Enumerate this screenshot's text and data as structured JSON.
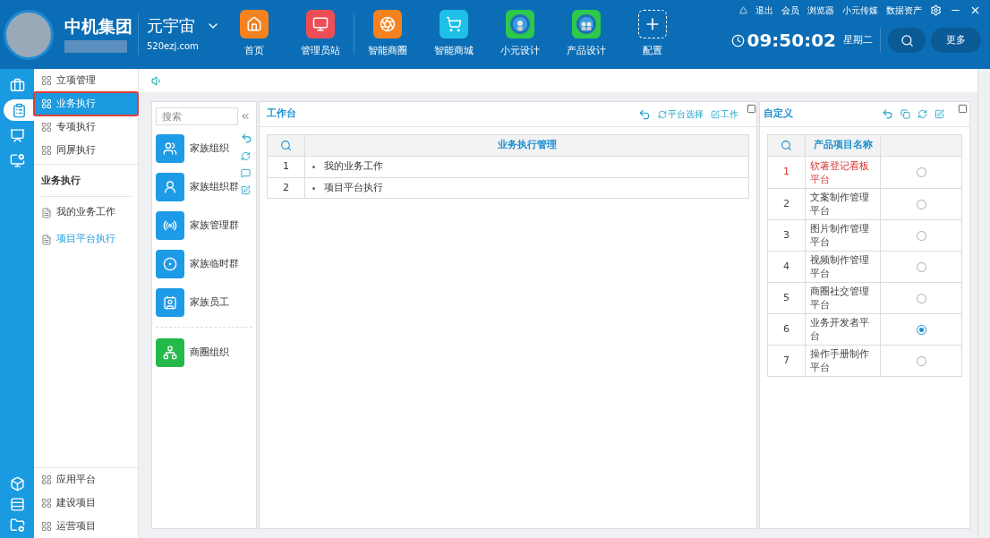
{
  "header": {
    "company": "中机集团",
    "brand": "元宇宙",
    "domain": "520ezj.com",
    "nav": [
      {
        "label": "首页",
        "kind": "home",
        "color": "#f5821f"
      },
      {
        "label": "管理员站",
        "kind": "monitor",
        "color": "#ee4d55"
      },
      {
        "label": "智能商圈",
        "kind": "aperture",
        "color": "#f5821f"
      },
      {
        "label": "智能商城",
        "kind": "cart",
        "color": "#1ec0e8"
      },
      {
        "label": "小元设计",
        "kind": "globe",
        "color": "#2ec84a"
      },
      {
        "label": "产品设计",
        "kind": "globe2",
        "color": "#2ec84a"
      },
      {
        "label": "配置",
        "kind": "add",
        "color": "#0b6db5"
      }
    ],
    "top_links": [
      "退出",
      "会员",
      "浏览器",
      "小元传媒",
      "数据资产"
    ],
    "time": "09:50:02",
    "weekday": "星期二",
    "more": "更多"
  },
  "rail": [
    {
      "kind": "briefcase",
      "selected": false
    },
    {
      "kind": "list",
      "selected": true
    },
    {
      "kind": "chart",
      "selected": false
    },
    {
      "kind": "screen",
      "selected": false
    }
  ],
  "rail_bottom": [
    {
      "kind": "cube"
    },
    {
      "kind": "rows"
    },
    {
      "kind": "folder"
    }
  ],
  "menu": {
    "items": [
      {
        "label": "立项管理",
        "selected": false
      },
      {
        "label": "业务执行",
        "selected": true
      },
      {
        "label": "专项执行",
        "selected": false
      },
      {
        "label": "同屏执行",
        "selected": false
      }
    ],
    "section_title": "业务执行",
    "sub_items": [
      {
        "label": "我的业务工作",
        "selected": false
      },
      {
        "label": "项目平台执行",
        "selected": true
      }
    ],
    "bottom_items": [
      "应用平台",
      "建设项目",
      "运营项目"
    ]
  },
  "groups": {
    "search_placeholder": "搜索",
    "items": [
      {
        "label": "家族组织",
        "kind": "people",
        "color": "#1e9be6"
      },
      {
        "label": "家族组织群",
        "kind": "person",
        "color": "#1e9be6"
      },
      {
        "label": "家族管理群",
        "kind": "signal",
        "color": "#1e9be6"
      },
      {
        "label": "家族临时群",
        "kind": "ring",
        "color": "#1e9be6"
      },
      {
        "label": "家族员工",
        "kind": "badge",
        "color": "#1e9be6"
      },
      {
        "label": "商圈组织",
        "kind": "org",
        "color": "#25b84a"
      }
    ]
  },
  "workbench": {
    "title": "工作台",
    "actions": [
      "平台选择",
      "工作"
    ],
    "column": "业务执行管理",
    "rows": [
      {
        "no": "1",
        "label": "我的业务工作"
      },
      {
        "no": "2",
        "label": "项目平台执行"
      }
    ]
  },
  "custom": {
    "title": "自定义",
    "column": "产品项目名称",
    "rows": [
      {
        "no": "1",
        "label": "软著登记看板平台",
        "highlighted": true,
        "selected": false
      },
      {
        "no": "2",
        "label": "文案制作管理平台",
        "highlighted": false,
        "selected": false
      },
      {
        "no": "3",
        "label": "图片制作管理平台",
        "highlighted": false,
        "selected": false
      },
      {
        "no": "4",
        "label": "视频制作管理平台",
        "highlighted": false,
        "selected": false
      },
      {
        "no": "5",
        "label": "商圈社交管理平台",
        "highlighted": false,
        "selected": false
      },
      {
        "no": "6",
        "label": "业务开发者平台",
        "highlighted": false,
        "selected": true
      },
      {
        "no": "7",
        "label": "操作手册制作平台",
        "highlighted": false,
        "selected": false
      }
    ]
  }
}
